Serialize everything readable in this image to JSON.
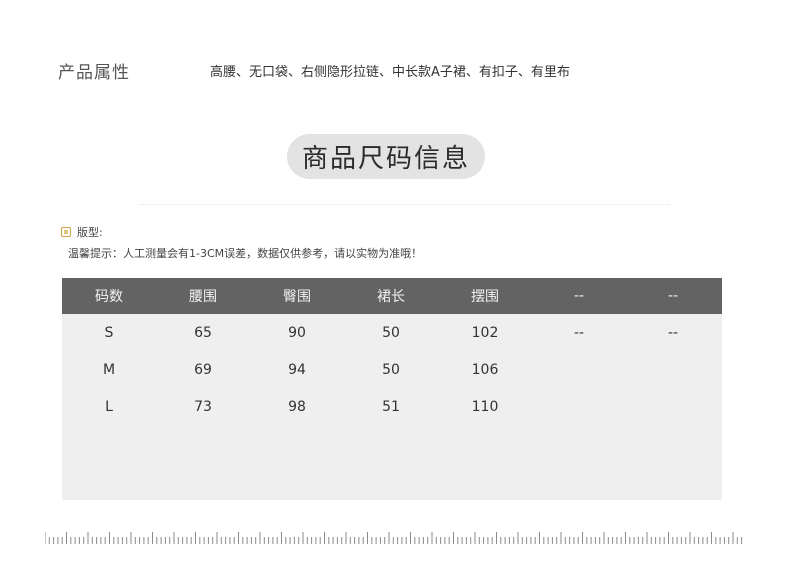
{
  "attributes": {
    "label": "产品属性",
    "value": "高腰、无口袋、右侧隐形拉链、中长款A子裙、有扣子、有里布"
  },
  "section": {
    "title": "商品尺码信息"
  },
  "version": {
    "label": "版型:"
  },
  "tip": "温馨提示：人工测量会有1-3CM误差，数据仅供参考，请以实物为准哦！",
  "table": {
    "headers": [
      "码数",
      "腰围",
      "臀围",
      "裙长",
      "摆围",
      "--",
      "--"
    ],
    "rows": [
      [
        "S",
        "65",
        "90",
        "50",
        "102",
        "--",
        "--"
      ],
      [
        "M",
        "69",
        "94",
        "50",
        "106",
        "",
        ""
      ],
      [
        "L",
        "73",
        "98",
        "51",
        "110",
        "",
        ""
      ]
    ]
  }
}
